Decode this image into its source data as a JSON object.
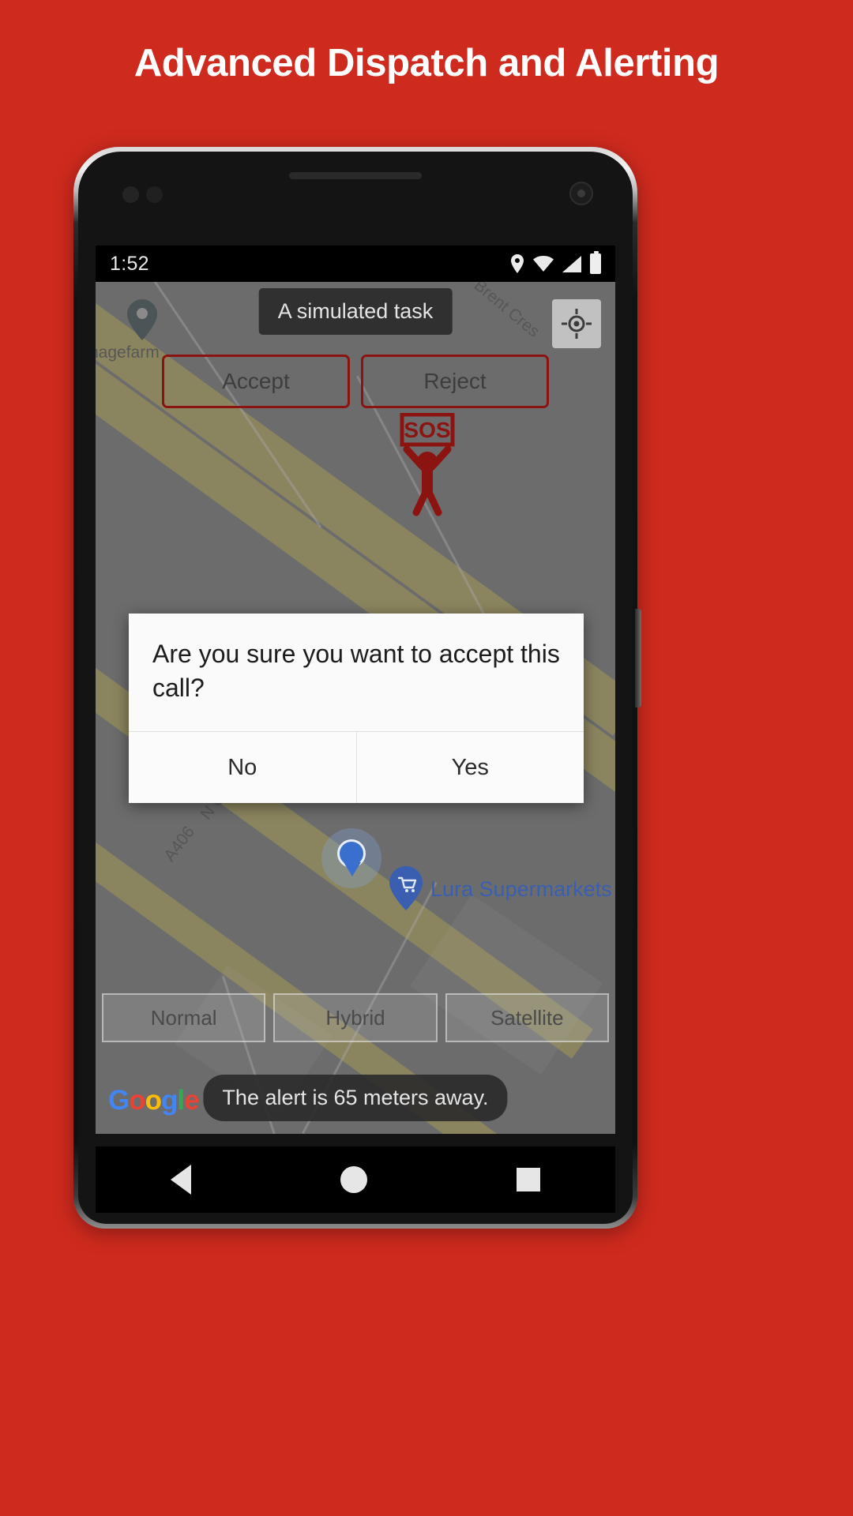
{
  "headline": "Advanced Dispatch and Alerting",
  "theme": {
    "background": "#cf2a1e",
    "accent_dark_red": "#8c1410",
    "map_base": "#9e9e9e",
    "road_yellow": "#cfc684",
    "poi_blue": "#3a5fb0"
  },
  "phone": {
    "status_bar": {
      "clock": "1:52",
      "icons": [
        "location-icon",
        "wifi-icon",
        "signal-icon",
        "battery-icon"
      ]
    },
    "navigation_bar": {
      "back": "back-triangle-icon",
      "home": "home-circle-icon",
      "recents": "recents-square-icon"
    }
  },
  "app": {
    "toast_top": "A simulated task",
    "toast_bottom": "The alert is 65 meters away.",
    "task_actions": [
      {
        "label": "Accept",
        "name": "accept-button"
      },
      {
        "label": "Reject",
        "name": "reject-button"
      }
    ],
    "sos_label": "SOS",
    "gps_button": "my-location-icon",
    "map_types": [
      {
        "label": "Normal"
      },
      {
        "label": "Hybrid"
      },
      {
        "label": "Satellite"
      }
    ],
    "map_labels": [
      {
        "text": "Brent Cres"
      },
      {
        "text": "N Circular"
      },
      {
        "text": "A406"
      },
      {
        "text": "nagefarm"
      }
    ],
    "poi": {
      "name": "Lura Supermarkets"
    },
    "attribution": {
      "g1": "G",
      "g2": "o",
      "g3": "o",
      "g4": "g",
      "g5": "l",
      "g6": "e"
    },
    "dialog": {
      "message": "Are you sure you want to accept this call?",
      "buttons": [
        {
          "label": "No",
          "name": "dialog-no-button"
        },
        {
          "label": "Yes",
          "name": "dialog-yes-button"
        }
      ]
    }
  }
}
